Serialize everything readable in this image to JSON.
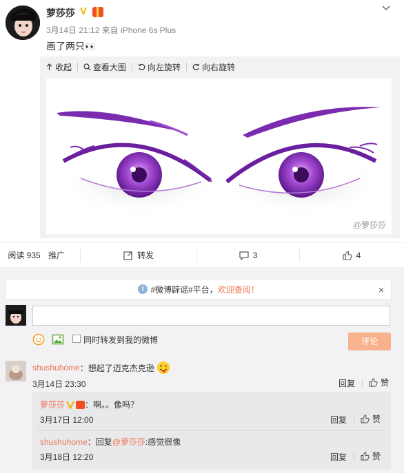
{
  "post": {
    "author": "萝莎莎",
    "verified_badge": "V",
    "time": "3月14日 21:12",
    "source_prefix": "来自",
    "source": "iPhone 6s Plus",
    "text": "画了两只",
    "text_emoji": "👀"
  },
  "image_toolbar": {
    "collapse": "收起",
    "view_large": "查看大图",
    "rotate_left": "向左旋转",
    "rotate_right": "向右旋转"
  },
  "image": {
    "watermark": "@萝莎莎"
  },
  "actions": {
    "reads": "阅读 935",
    "promote": "推广",
    "repost": "转发",
    "comments": "3",
    "likes": "4"
  },
  "notice": {
    "text": "#微博辟谣#平台，",
    "link": "欢迎查阅！",
    "close": "×"
  },
  "composer": {
    "repost_label": "同时转发到我的微博",
    "submit": "评论"
  },
  "comments": [
    {
      "user": "shushuhome",
      "text": "：想起了迈克杰克逊",
      "time": "3月14日 23:30",
      "reply_label": "回复",
      "like_label": "赞",
      "replies": [
        {
          "user": "萝莎莎",
          "text": "：啊。。像吗？",
          "time": "3月17日 12:00",
          "reply_label": "回复",
          "like_label": "赞"
        },
        {
          "user": "shushuhome",
          "prefix": "：回复",
          "mention": "@萝莎莎",
          "text": ":感觉很像",
          "time": "3月18日 12:20",
          "reply_label": "回复",
          "like_label": "赞"
        }
      ]
    }
  ],
  "colors": {
    "accent": "#eb7350",
    "eye_purple": "#7a2bb0",
    "badge_gold": "#f7b500",
    "submit_bg": "#f8b38e"
  }
}
